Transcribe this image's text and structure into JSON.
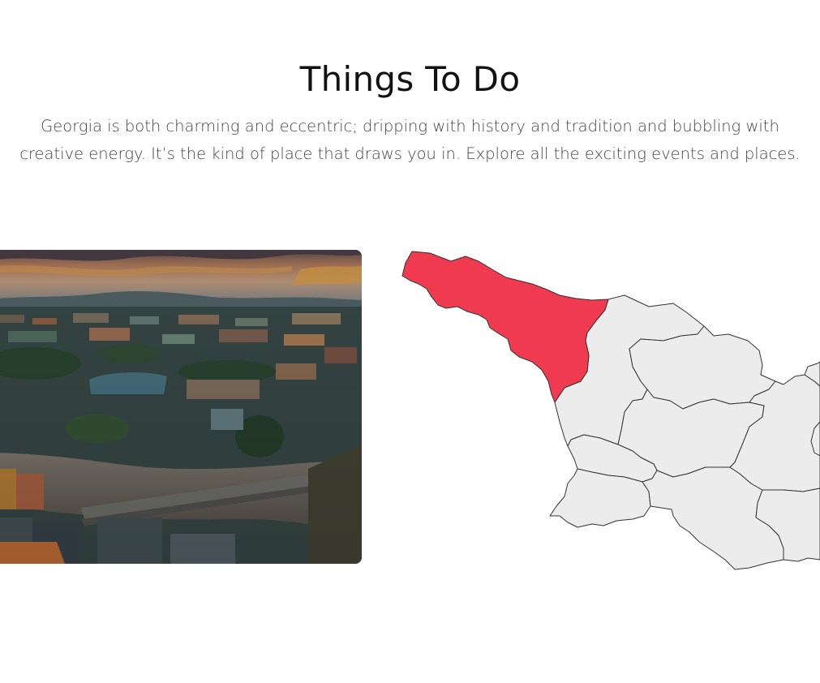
{
  "section": {
    "title": "Things To Do",
    "intro_line_1": "Georgia is both charming and eccentric; dripping with history and tradition and bubbling with",
    "intro_line_2": "creative energy. It’s the kind of place that draws you in. Explore all the exciting events and places."
  },
  "photo": {
    "subject": "aerial view of a riverside city with bridge, dome building and mountains at sunset"
  },
  "map": {
    "country": "Georgia",
    "highlight_color": "#ef3a4f",
    "region_fill": "#ececec",
    "border_color": "#333333",
    "selected_region": "northwest region"
  }
}
